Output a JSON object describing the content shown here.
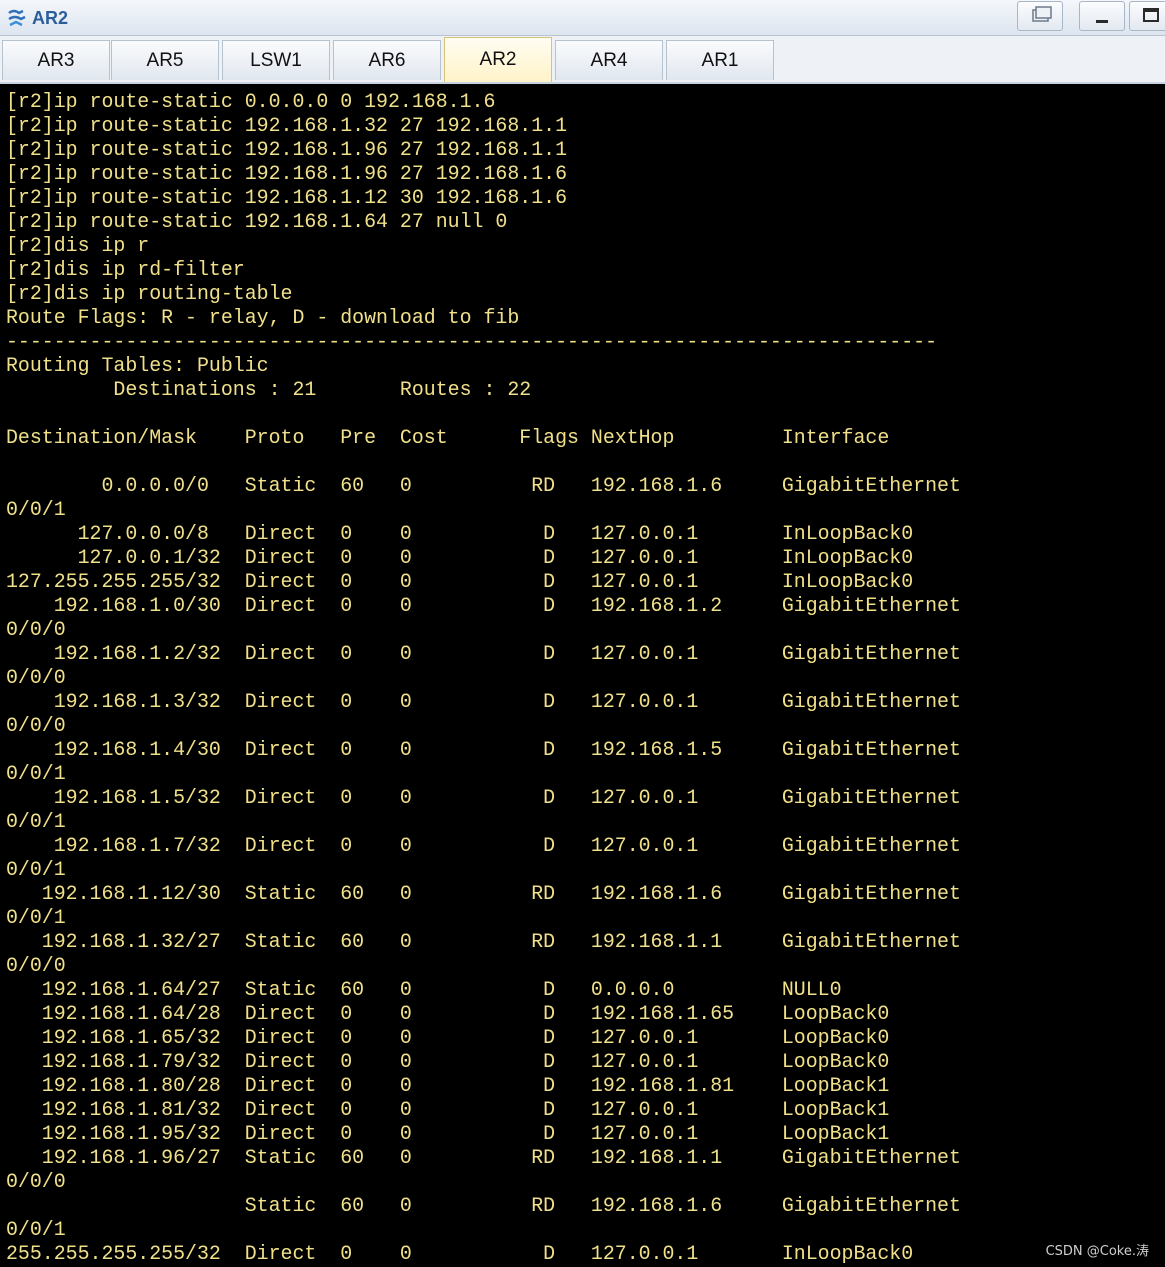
{
  "window": {
    "title": "AR2",
    "icon": "router-icon",
    "controls": [
      "restore-icon",
      "minimize-icon",
      "maximize-icon"
    ]
  },
  "tabs": [
    {
      "label": "AR3",
      "active": false
    },
    {
      "label": "AR5",
      "active": false
    },
    {
      "label": "LSW1",
      "active": false
    },
    {
      "label": "AR6",
      "active": false
    },
    {
      "label": "AR2",
      "active": true
    },
    {
      "label": "AR4",
      "active": false
    },
    {
      "label": "AR1",
      "active": false
    }
  ],
  "terminal": {
    "text_color": "#f0e08a",
    "background": "#000000",
    "lines": [
      "[r2]ip route-static 0.0.0.0 0 192.168.1.6",
      "[r2]ip route-static 192.168.1.32 27 192.168.1.1",
      "[r2]ip route-static 192.168.1.96 27 192.168.1.1",
      "[r2]ip route-static 192.168.1.96 27 192.168.1.6",
      "[r2]ip route-static 192.168.1.12 30 192.168.1.6",
      "[r2]ip route-static 192.168.1.64 27 null 0",
      "[r2]dis ip r",
      "[r2]dis ip rd-filter",
      "[r2]dis ip routing-table",
      "Route Flags: R - relay, D - download to fib",
      "------------------------------------------------------------------------------",
      "Routing Tables: Public",
      "         Destinations : 21       Routes : 22",
      "",
      "Destination/Mask    Proto   Pre  Cost      Flags NextHop         Interface",
      "",
      "        0.0.0.0/0   Static  60   0          RD   192.168.1.6     GigabitEthernet",
      "0/0/1",
      "      127.0.0.0/8   Direct  0    0           D   127.0.0.1       InLoopBack0",
      "      127.0.0.1/32  Direct  0    0           D   127.0.0.1       InLoopBack0",
      "127.255.255.255/32  Direct  0    0           D   127.0.0.1       InLoopBack0",
      "    192.168.1.0/30  Direct  0    0           D   192.168.1.2     GigabitEthernet",
      "0/0/0",
      "    192.168.1.2/32  Direct  0    0           D   127.0.0.1       GigabitEthernet",
      "0/0/0",
      "    192.168.1.3/32  Direct  0    0           D   127.0.0.1       GigabitEthernet",
      "0/0/0",
      "    192.168.1.4/30  Direct  0    0           D   192.168.1.5     GigabitEthernet",
      "0/0/1",
      "    192.168.1.5/32  Direct  0    0           D   127.0.0.1       GigabitEthernet",
      "0/0/1",
      "    192.168.1.7/32  Direct  0    0           D   127.0.0.1       GigabitEthernet",
      "0/0/1",
      "   192.168.1.12/30  Static  60   0          RD   192.168.1.6     GigabitEthernet",
      "0/0/1",
      "   192.168.1.32/27  Static  60   0          RD   192.168.1.1     GigabitEthernet",
      "0/0/0",
      "   192.168.1.64/27  Static  60   0           D   0.0.0.0         NULL0",
      "   192.168.1.64/28  Direct  0    0           D   192.168.1.65    LoopBack0",
      "   192.168.1.65/32  Direct  0    0           D   127.0.0.1       LoopBack0",
      "   192.168.1.79/32  Direct  0    0           D   127.0.0.1       LoopBack0",
      "   192.168.1.80/28  Direct  0    0           D   192.168.1.81    LoopBack1",
      "   192.168.1.81/32  Direct  0    0           D   127.0.0.1       LoopBack1",
      "   192.168.1.95/32  Direct  0    0           D   127.0.0.1       LoopBack1",
      "   192.168.1.96/27  Static  60   0          RD   192.168.1.1     GigabitEthernet",
      "0/0/0",
      "                    Static  60   0          RD   192.168.1.6     GigabitEthernet",
      "0/0/1",
      "255.255.255.255/32  Direct  0    0           D   127.0.0.1       InLoopBack0"
    ]
  },
  "watermark": "CSDN @Coke.涛"
}
